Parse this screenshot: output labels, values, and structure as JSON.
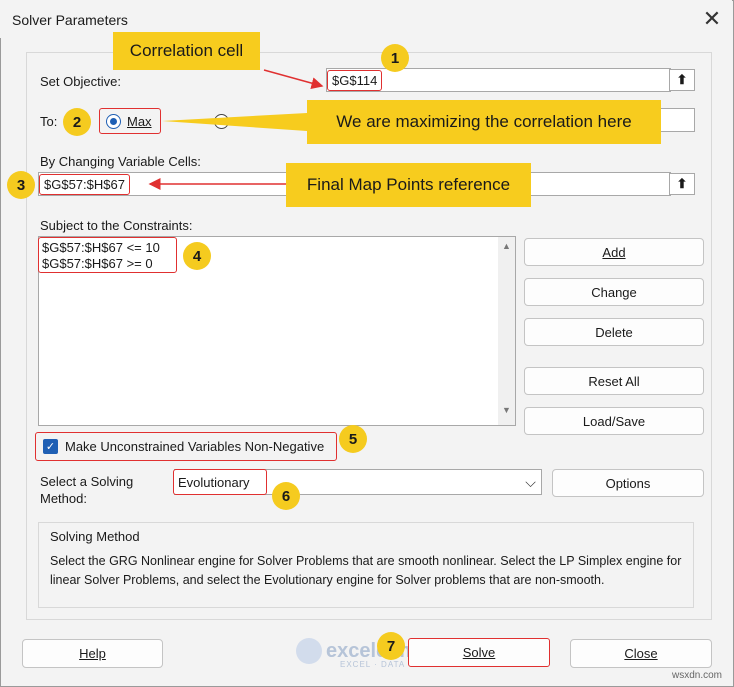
{
  "window": {
    "title": "Solver Parameters",
    "close_glyph": "✕"
  },
  "objective": {
    "label": "Set Objective:",
    "value": "$G$114",
    "ref_button": "⬆"
  },
  "to": {
    "label": "To:",
    "max_label": "Max",
    "max_selected": true
  },
  "changing_cells": {
    "label": "By Changing Variable Cells:",
    "value": "$G$57:$H$67",
    "ref_button": "⬆"
  },
  "constraints": {
    "label": "Subject to the Constraints:",
    "items": [
      "$G$57:$H$67 <= 10",
      "$G$57:$H$67 >= 0"
    ],
    "scroll_up": "▲",
    "scroll_down": "▼"
  },
  "buttons": {
    "add": "Add",
    "change": "Change",
    "delete": "Delete",
    "reset_all": "Reset All",
    "load_save": "Load/Save",
    "options": "Options",
    "help": "Help",
    "solve": "Solve",
    "close": "Close"
  },
  "nonneg": {
    "label": "Make Unconstrained Variables Non-Negative",
    "checked": true,
    "check_glyph": "✓"
  },
  "solving_method": {
    "label_line1": "Select a Solving",
    "label_line2": "Method:",
    "value": "Evolutionary",
    "dropdown_glyph": "⌵"
  },
  "method_info": {
    "title": "Solving Method",
    "text": "Select the GRG Nonlinear engine for Solver Problems that are smooth nonlinear. Select the LP Simplex engine for linear Solver Problems, and select the Evolutionary engine for Solver problems that are non-smooth."
  },
  "annotations": {
    "callout_correlation": "Correlation cell",
    "callout_maximizing": "We are maximizing the correlation here",
    "callout_final_map": "Final Map Points reference",
    "badges": [
      "1",
      "2",
      "3",
      "4",
      "5",
      "6",
      "7"
    ]
  },
  "watermark": {
    "brand": "exceldemy",
    "tagline": "EXCEL · DATA · BI",
    "corner": "wsxdn.com"
  },
  "colors": {
    "accent_blue": "#1e5fb4",
    "annotation_red": "#e03030",
    "callout_yellow": "#f7cc1e",
    "badge_yellow": "#f5cb1f"
  }
}
